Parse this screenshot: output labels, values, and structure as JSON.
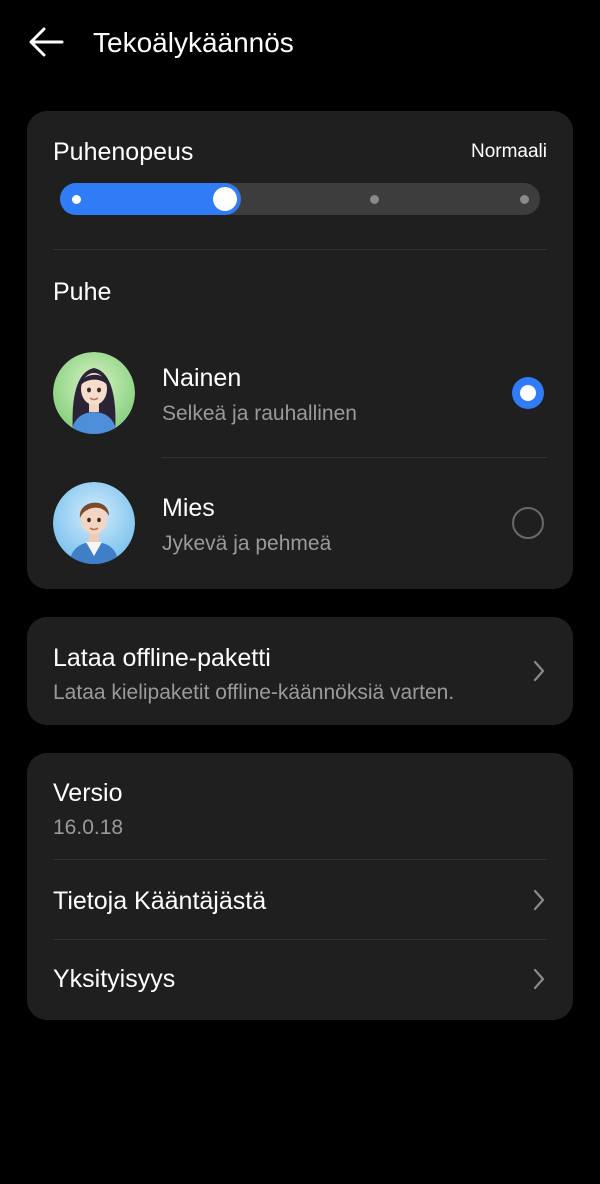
{
  "header": {
    "title": "Tekoälykäännös",
    "back_icon": "arrow-left-icon"
  },
  "speed": {
    "label": "Puhenopeus",
    "value": "Normaali",
    "level_index": 1,
    "level_count": 4,
    "accent_color": "#2f7cf6"
  },
  "voice": {
    "heading": "Puhe",
    "options": [
      {
        "name": "Nainen",
        "description": "Selkeä ja rauhallinen",
        "selected": true,
        "avatar_icon": "female-avatar-icon"
      },
      {
        "name": "Mies",
        "description": "Jykevä ja pehmeä",
        "selected": false,
        "avatar_icon": "male-avatar-icon"
      }
    ]
  },
  "offline": {
    "title": "Lataa offline-paketti",
    "subtitle": "Lataa kielipaketit offline-käännöksiä varten.",
    "chevron_icon": "chevron-right-icon"
  },
  "info": {
    "version_label": "Versio",
    "version_value": "16.0.18",
    "about_label": "Tietoja Kääntäjästä",
    "privacy_label": "Yksityisyys"
  },
  "colors": {
    "background": "#000000",
    "card": "#1f1f1f",
    "accent": "#2f7cf6",
    "secondary_text": "#9a9a9a"
  }
}
